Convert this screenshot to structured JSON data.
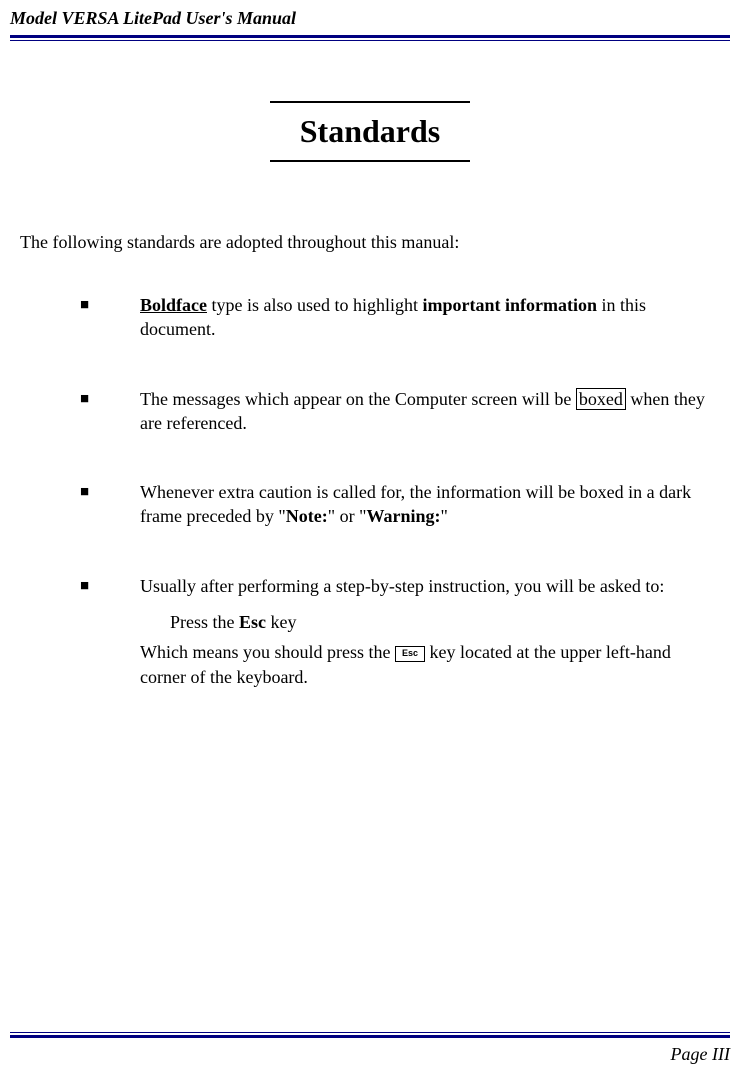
{
  "header": {
    "title": "Model VERSA LitePad User's Manual"
  },
  "chapter": {
    "title": "Standards"
  },
  "intro": "The following standards are adopted throughout this manual:",
  "bullets": {
    "b1": {
      "bold_underline": "Boldface",
      "mid": " type is also used to highlight ",
      "bold2": "important information",
      "tail": " in this document."
    },
    "b2": {
      "pre": "The messages which appear on the Computer screen will be ",
      "boxed": "boxed",
      "post": " when they are referenced."
    },
    "b3": {
      "pre": "Whenever extra caution is called for, the information will be boxed in a dark frame preceded by \"",
      "note": "Note:",
      "mid": "\" or \"",
      "warning": "Warning:",
      "post": "\""
    },
    "b4": {
      "main": "Usually after performing a step-by-step instruction, you will be asked to:",
      "sub1_pre": "Press the ",
      "sub1_esc": "Esc",
      "sub1_post": " key",
      "sub2_pre": "Which means you should press the  ",
      "key_label": "Esc",
      "sub2_post": " key located at the upper left-hand corner of the keyboard."
    }
  },
  "footer": {
    "page": "Page III"
  }
}
